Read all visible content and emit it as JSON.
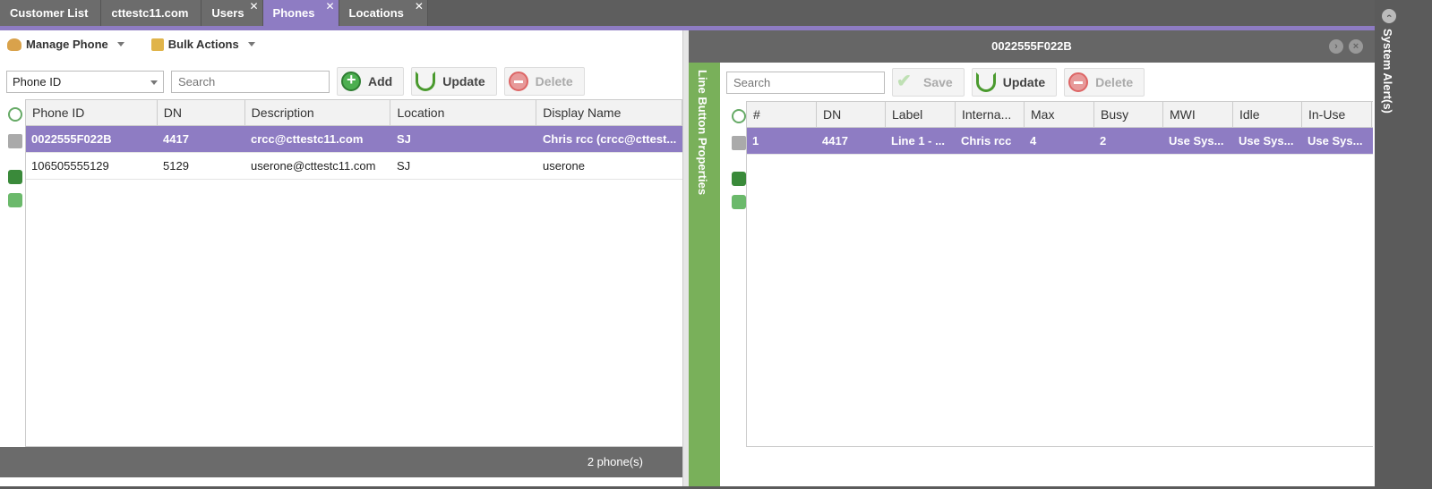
{
  "tabs": [
    {
      "label": "Customer List",
      "closable": false
    },
    {
      "label": "cttestc11.com",
      "closable": false
    },
    {
      "label": "Users",
      "closable": true
    },
    {
      "label": "Phones",
      "closable": true,
      "active": true
    },
    {
      "label": "Locations",
      "closable": true
    }
  ],
  "tab_close_glyph": "✕",
  "accent_color": "#8e7cc3",
  "left": {
    "menus": {
      "manage_phone": "Manage Phone",
      "bulk_actions": "Bulk Actions"
    },
    "filter_select": "Phone ID",
    "search_placeholder": "Search",
    "buttons": {
      "add": "Add",
      "update": "Update",
      "delete": "Delete"
    },
    "columns": [
      "Phone ID",
      "DN",
      "Description",
      "Location",
      "Display Name"
    ],
    "rows": [
      [
        "0022555F022B",
        "4417",
        "crcc@cttestc11.com",
        "SJ",
        "Chris rcc (crcc@cttest..."
      ],
      [
        "106505555129",
        "5129",
        "userone@cttestc11.com",
        "SJ",
        "userone"
      ]
    ],
    "footer_count": "2 phone(s)"
  },
  "right": {
    "title": "0022555F022B",
    "side_tab": "Line Button Properties",
    "search_placeholder": "Search",
    "buttons": {
      "save": "Save",
      "update": "Update",
      "delete": "Delete"
    },
    "columns": [
      "#",
      "DN",
      "Label",
      "Interna...",
      "Max",
      "Busy",
      "MWI",
      "Idle",
      "In-Use"
    ],
    "rows": [
      [
        "1",
        "4417",
        "Line 1 - ...",
        "Chris rcc",
        "4",
        "2",
        "Use Sys...",
        "Use Sys...",
        "Use Sys..."
      ]
    ]
  },
  "alerts_label": "System Alert(s)",
  "icons": [
    "manage-phone-icon",
    "bulk-actions-icon",
    "add-icon",
    "update-icon",
    "delete-icon",
    "save-icon",
    "refresh-icon",
    "print-icon",
    "excel-icon",
    "csv-icon",
    "next-icon",
    "close-icon",
    "collapse-icon"
  ]
}
